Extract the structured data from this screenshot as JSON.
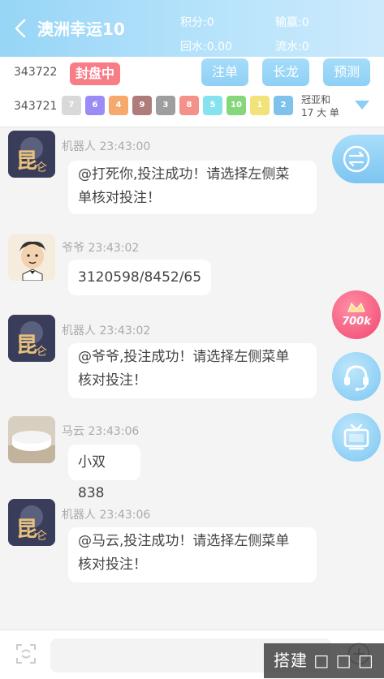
{
  "header": {
    "title": "澳洲幸运10",
    "stats": {
      "points": "积分:0",
      "win_loss": "输赢:0",
      "rebate": "回水:0.00",
      "turnover": "流水:0"
    }
  },
  "draw_bar": {
    "current_issue": "343722",
    "status_badge": "封盘中",
    "buttons": [
      "注单",
      "长龙",
      "预测"
    ],
    "previous_issue": "343721",
    "balls": [
      "7",
      "6",
      "4",
      "9",
      "3",
      "8",
      "5",
      "10",
      "1",
      "2"
    ],
    "ball_colors": [
      "#d9d9d9",
      "#9b8cf5",
      "#f5a96c",
      "#b07b7b",
      "#9e9e9e",
      "#f4918a",
      "#86e3ee",
      "#86d67c",
      "#f1e27a",
      "#7fc3ec"
    ],
    "champion_label": "冠亚和",
    "champion_result": "17 大 单"
  },
  "messages": [
    {
      "sender": "机器人",
      "time": "23:43:00",
      "text_lines": [
        "@打死你,投注成功！请选择左侧菜",
        "单核对投注！"
      ]
    },
    {
      "sender": "爷爷",
      "time": "23:43:02",
      "text_lines": [
        "3120598/8452/65"
      ]
    },
    {
      "sender": "机器人",
      "time": "23:43:02",
      "text_lines": [
        "@爷爷,投注成功！请选择左侧菜单",
        "核对投注！"
      ]
    },
    {
      "sender": "马云",
      "time": "23:43:06",
      "text_lines": [
        "小双838"
      ]
    },
    {
      "sender": "机器人",
      "time": "23:43:06",
      "text_lines": [
        "@马云,投注成功！请选择左侧菜单",
        "核对投注！"
      ]
    }
  ],
  "float_buttons": {
    "promo_label": "700k"
  },
  "overlay": {
    "text": "搭建 □ □ □"
  },
  "colors": {
    "header_gradient_start": "#97d5f6",
    "accent": "#8ed0f5",
    "badge": "#f87d87"
  }
}
